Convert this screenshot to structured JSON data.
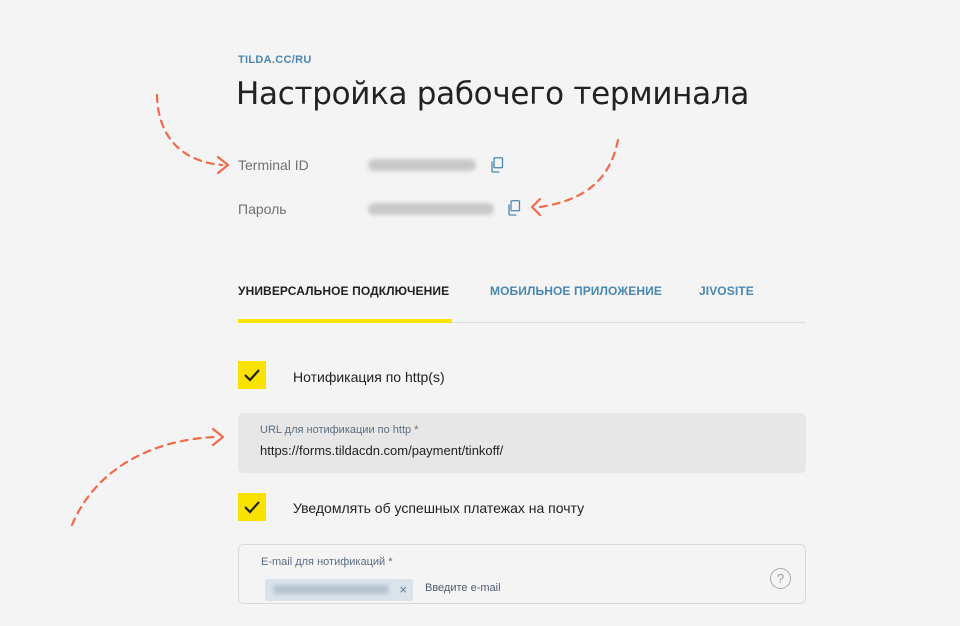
{
  "header": {
    "breadcrumb": "TILDA.CC/RU",
    "title": "Настройка рабочего терминала"
  },
  "credentials": {
    "terminal_id_label": "Terminal ID",
    "password_label": "Пароль"
  },
  "tabs": [
    {
      "label": "УНИВЕРСАЛЬНОЕ ПОДКЛЮЧЕНИЕ",
      "active": true
    },
    {
      "label": "МОБИЛЬНОЕ ПРИЛОЖЕНИЕ",
      "active": false
    },
    {
      "label": "JIVOSITE",
      "active": false
    }
  ],
  "http_notification": {
    "checkbox_label": "Нотификация по http(s)",
    "checked": true,
    "url_label": "URL для нотификации по http *",
    "url_value": "https://forms.tildacdn.com/payment/tinkoff/"
  },
  "email_notification": {
    "checkbox_label": "Уведомлять об успешных платежах на почту",
    "checked": true,
    "email_label": "E-mail для нотификаций *",
    "chip_close": "×",
    "email_placeholder": "Введите e-mail",
    "help": "?"
  },
  "colors": {
    "accent_yellow": "#fae200",
    "link_blue": "#4a87b0",
    "annotation_arrow": "#f06a4b"
  }
}
